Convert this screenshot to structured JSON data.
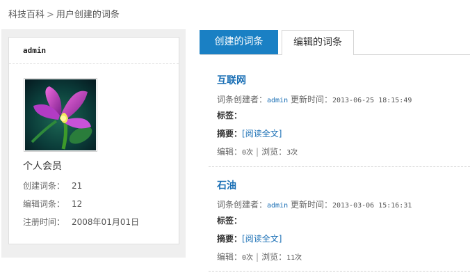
{
  "breadcrumb": {
    "home": "科技百科",
    "separator": ">",
    "current": "用户创建的词条"
  },
  "profile": {
    "username": "admin",
    "member_type": "个人会员",
    "stats": [
      {
        "label": "创建词条：",
        "value": "21"
      },
      {
        "label": "编辑词条：",
        "value": "12"
      },
      {
        "label": "注册时间：",
        "value": "2008年01月01日"
      }
    ]
  },
  "tabs": {
    "created": "创建的词条",
    "edited": "编辑的词条"
  },
  "entries": [
    {
      "title": "互联网",
      "creator_label": "词条创建者：",
      "creator": "admin",
      "updated_label": "更新时间：",
      "updated": "2013-06-25 18:15:49",
      "tags_label": "标签：",
      "summary_label": "摘要：",
      "read_more": "[阅读全文]",
      "edit_label": "编辑：",
      "edits": "0次",
      "separator": "|",
      "view_label": "浏览：",
      "views": "3次"
    },
    {
      "title": "石油",
      "creator_label": "词条创建者：",
      "creator": "admin",
      "updated_label": "更新时间：",
      "updated": "2013-03-06 15:16:31",
      "tags_label": "标签：",
      "summary_label": "摘要：",
      "read_more": "[阅读全文]",
      "edit_label": "编辑：",
      "edits": "0次",
      "separator": "|",
      "view_label": "浏览：",
      "views": "11次"
    }
  ],
  "colors": {
    "accent": "#1a80c4",
    "link": "#1a6fb5",
    "sidebar_bg": "#efefef"
  }
}
